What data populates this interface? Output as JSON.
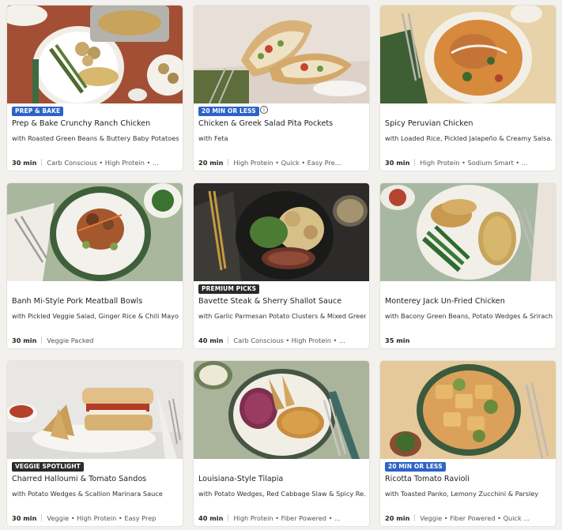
{
  "recipes": [
    {
      "badge": "PREP & BAKE",
      "title": "Prep & Bake Crunchy Ranch Chicken",
      "subtitle": "with Roasted Green Beans & Buttery Baby Potatoes",
      "time": "30 min",
      "tags": "Carb Conscious • High Protein • ..."
    },
    {
      "badge": "20 MIN OR LESS",
      "info_icon": "i",
      "title": "Chicken & Greek Salad Pita Pockets",
      "subtitle": "with Feta",
      "time": "20 min",
      "tags": "High Protein • Quick • Easy Pre..."
    },
    {
      "title": "Spicy Peruvian Chicken",
      "subtitle": "with Loaded Rice, Pickled Jalapeño & Creamy Salsa...",
      "time": "30 min",
      "tags": "High Protein • Sodium Smart • ..."
    },
    {
      "title": "Banh Mi-Style Pork Meatball Bowls",
      "subtitle": "with Pickled Veggie Salad, Ginger Rice & Chili Mayo",
      "time": "30 min",
      "tags": "Veggie Packed"
    },
    {
      "badge": "PREMIUM PICKS",
      "title": "Bavette Steak & Sherry Shallot Sauce",
      "subtitle": "with Garlic Parmesan Potato Clusters & Mixed Greens",
      "time": "40 min",
      "tags": "Carb Conscious • High Protein • ..."
    },
    {
      "title": "Monterey Jack Un-Fried Chicken",
      "subtitle": "with Bacony Green Beans, Potato Wedges & Srirach...",
      "time": "35 min",
      "tags": ""
    },
    {
      "badge": "VEGGIE SPOTLIGHT",
      "title": "Charred Halloumi & Tomato Sandos",
      "subtitle": "with Potato Wedges & Scallion Marinara Sauce",
      "time": "30 min",
      "tags": "Veggie • High Protein • Easy Prep"
    },
    {
      "title": "Louisiana-Style Tilapia",
      "subtitle": "with Potato Wedges, Red Cabbage Slaw & Spicy Re...",
      "time": "40 min",
      "tags": "High Protein • Fiber Powered • ..."
    },
    {
      "badge": "20 MIN OR LESS",
      "title": "Ricotta Tomato Ravioli",
      "subtitle": "with Toasted Panko, Lemony Zucchini & Parsley",
      "time": "20 min",
      "tags": "Veggie • Fiber Powered • Quick ..."
    }
  ]
}
